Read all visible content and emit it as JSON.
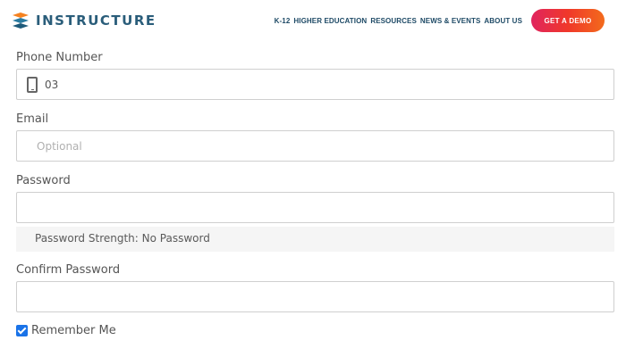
{
  "header": {
    "logo_text": "INSTRUCTURE",
    "nav": [
      "K-12",
      "HIGHER EDUCATION",
      "RESOURCES",
      "NEWS & EVENTS",
      "ABOUT US"
    ],
    "cta_label": "GET A DEMO"
  },
  "form": {
    "phone": {
      "label": "Phone Number",
      "value": "03"
    },
    "email": {
      "label": "Email",
      "placeholder": "Optional",
      "value": ""
    },
    "password": {
      "label": "Password",
      "value": "",
      "strength_text": "Password Strength: No Password"
    },
    "confirm_password": {
      "label": "Confirm Password",
      "value": ""
    },
    "remember_me": {
      "label": "Remember Me",
      "checked": true
    }
  },
  "colors": {
    "brand": "#2a5d7a",
    "cta_start": "#e0245e",
    "cta_end": "#f36b1c",
    "checkbox": "#1a73e8"
  }
}
